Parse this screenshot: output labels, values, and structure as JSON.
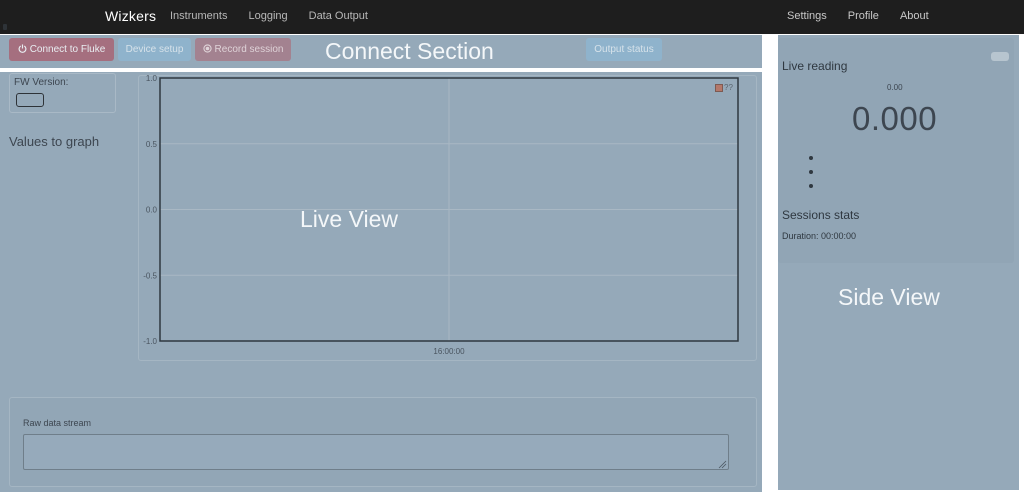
{
  "navbar": {
    "brand": "Wizkers",
    "left_links": [
      "Instruments",
      "Logging",
      "Data Output"
    ],
    "right_links": [
      "Settings",
      "Profile",
      "About"
    ]
  },
  "regions": {
    "connect_label": "Connect Section",
    "live_label": "Live View",
    "side_label": "Side View"
  },
  "toolbar": {
    "connect_label": "Connect to Fluke",
    "device_setup_label": "Device setup",
    "record_label": "Record session",
    "output_status_label": "Output status"
  },
  "device": {
    "fw_version_label": "FW Version:",
    "values_to_graph_label": "Values to graph"
  },
  "chart_data": {
    "type": "line",
    "y_ticks": [
      "1.0",
      "0.5",
      "0.0",
      "-0.5",
      "-1.0"
    ],
    "x_ticks": [
      "16:00:00"
    ],
    "ylim": [
      -1.0,
      1.0
    ],
    "series": [
      {
        "name": "??",
        "values": []
      }
    ],
    "legend_placement": "top-right",
    "grid": true
  },
  "raw_data": {
    "label": "Raw data stream",
    "value": ""
  },
  "side": {
    "live_reading_title": "Live reading",
    "small_reading": "0.00",
    "big_reading": "0.000",
    "sessions_title": "Sessions stats",
    "duration_text": "Duration: 00:00:00"
  },
  "colors": {
    "navbar_bg": "#1e1e1e",
    "overlay_bg": "#95a9b9",
    "connect_button": "#a56f7f",
    "legend_swatch": "#b4786a"
  }
}
